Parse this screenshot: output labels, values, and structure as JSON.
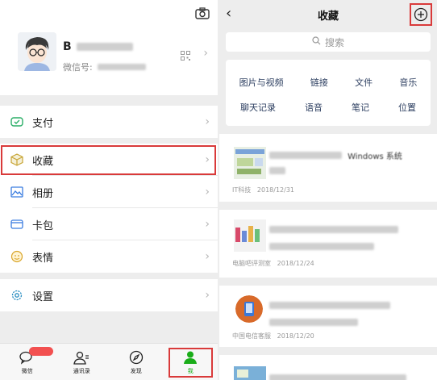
{
  "profile": {
    "name_visible": "B",
    "id_label": "微信号:",
    "camera_icon": "camera-icon",
    "qr_icon": "qr-code-icon"
  },
  "menu": {
    "items": [
      {
        "label": "支付",
        "icon": "wallet-icon"
      },
      {
        "label": "收藏",
        "icon": "favorites-cube-icon"
      },
      {
        "label": "相册",
        "icon": "photo-album-icon"
      },
      {
        "label": "卡包",
        "icon": "card-wallet-icon"
      },
      {
        "label": "表情",
        "icon": "emoji-icon"
      },
      {
        "label": "设置",
        "icon": "settings-gear-icon"
      }
    ]
  },
  "tabbar": {
    "tabs": [
      {
        "label": "微信",
        "icon": "chat-bubbles-icon"
      },
      {
        "label": "通讯录",
        "icon": "contacts-icon"
      },
      {
        "label": "发现",
        "icon": "compass-icon"
      },
      {
        "label": "我",
        "icon": "person-icon"
      }
    ],
    "active_tab": "我"
  },
  "favorites": {
    "title": "收藏",
    "search_placeholder": "搜索",
    "filters_row1": [
      "图片与视频",
      "链接",
      "文件",
      "音乐"
    ],
    "filters_row2": [
      "聊天记录",
      "语音",
      "笔记",
      "位置"
    ],
    "items": [
      {
        "title_visible": "Windows 系统",
        "source": "IT科技",
        "date": "2018/12/31"
      },
      {
        "source": "电脑吧评测室",
        "date": "2018/12/24"
      },
      {
        "source": "中国电信客服",
        "date": "2018/12/20"
      }
    ]
  },
  "colors": {
    "highlight": "#d93a3a",
    "accent_green": "#1aad19",
    "badge_red": "#f25050"
  }
}
